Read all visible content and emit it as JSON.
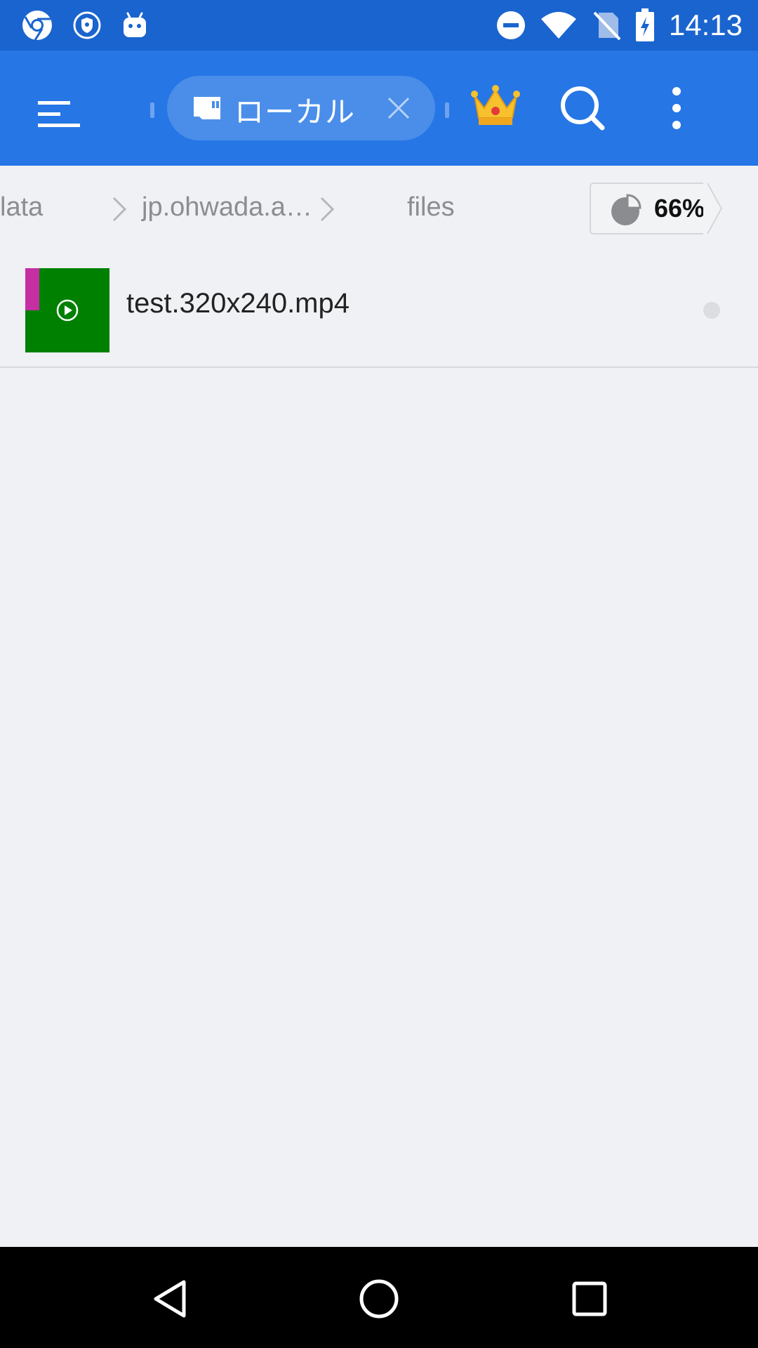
{
  "status_bar": {
    "time": "14:13",
    "left_icons": [
      "chrome-icon",
      "vpn-shield-icon",
      "android-debug-icon"
    ],
    "right_icons": [
      "do-not-disturb-icon",
      "wifi-icon",
      "no-sim-icon",
      "battery-charging-icon"
    ]
  },
  "app_bar": {
    "tab_label": "ローカル",
    "menu_icon": "menu-icon",
    "crown_icon": "crown-icon",
    "search_icon": "search-icon",
    "more_icon": "more-vert-icon"
  },
  "breadcrumb": {
    "items": [
      "data",
      "jp.ohwada.a…",
      "files"
    ],
    "displayed_first": "lata",
    "storage_percent": "66%"
  },
  "files": [
    {
      "name": "test.320x240.mp4",
      "type": "video"
    }
  ],
  "colors": {
    "status_bar": "#1a64cf",
    "app_bar": "#2676e5",
    "background": "#f0f1f4",
    "thumb_green": "#008000",
    "thumb_magenta": "#c62ea4"
  },
  "nav_bar": {
    "icons": [
      "back-icon",
      "home-icon",
      "recents-icon"
    ]
  }
}
